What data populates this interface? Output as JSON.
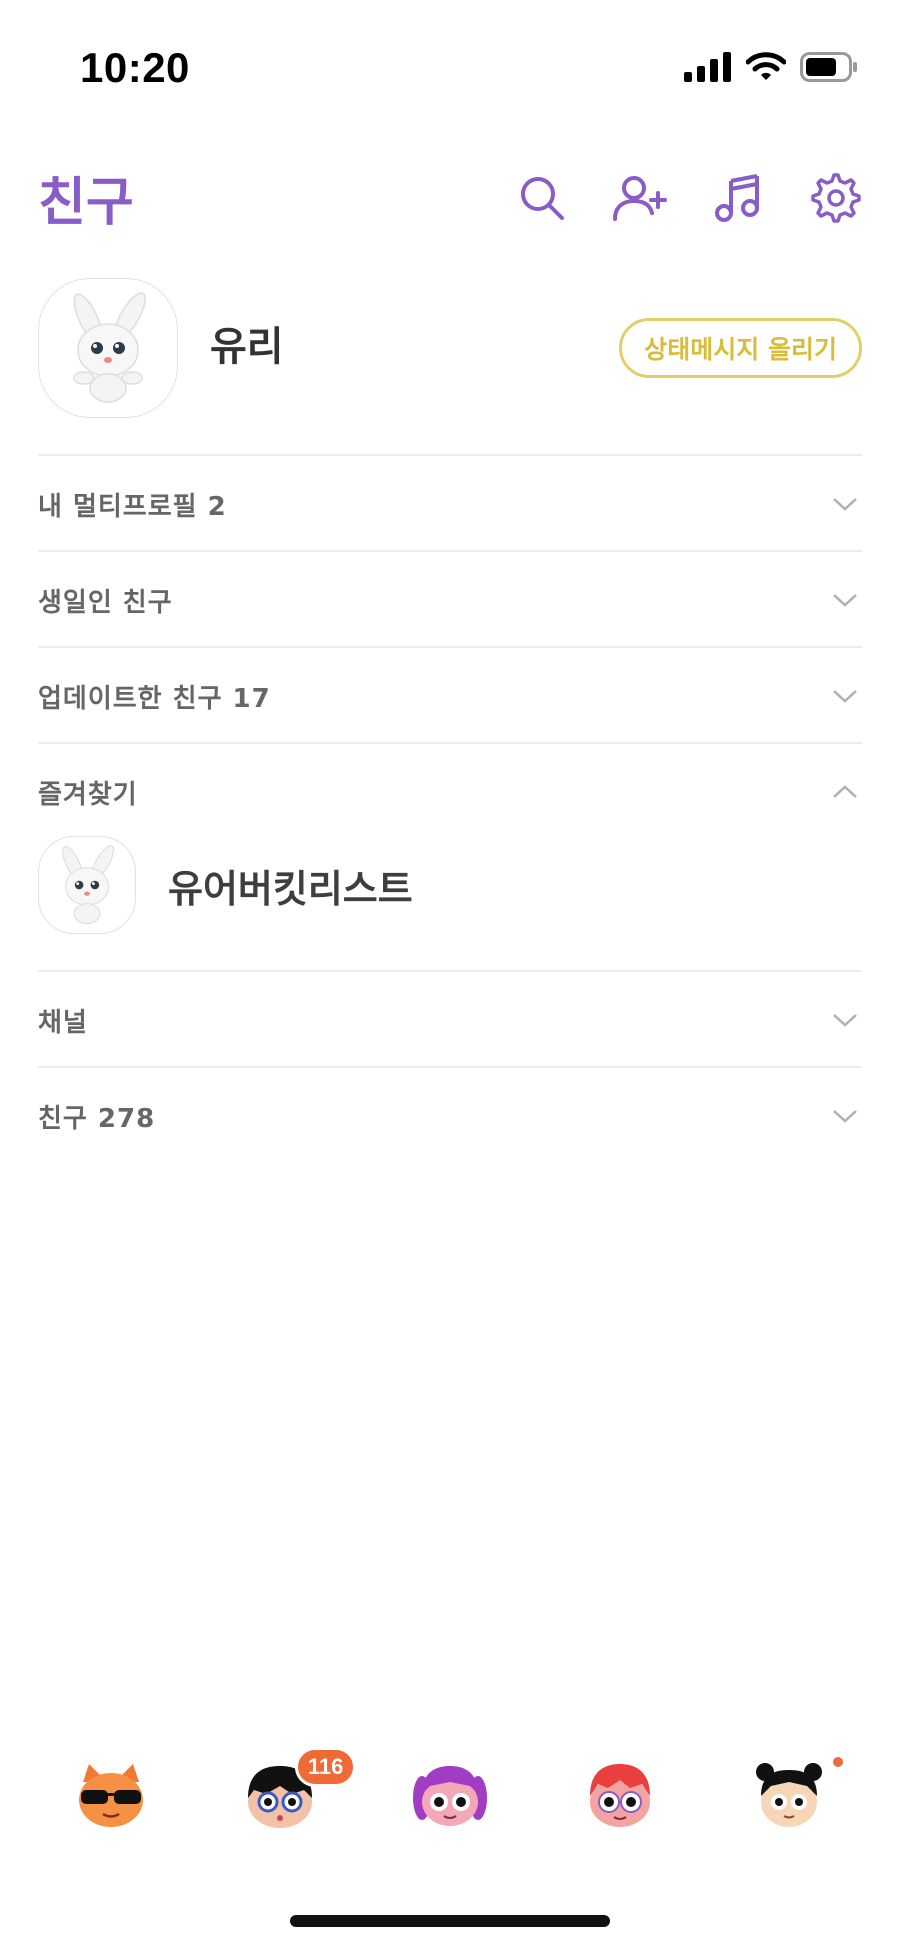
{
  "status_bar": {
    "time": "10:20"
  },
  "header": {
    "title": "친구"
  },
  "profile": {
    "name": "유리",
    "status_button": "상태메시지 올리기"
  },
  "sections": [
    {
      "label": "내 멀티프로필 2",
      "expanded": false
    },
    {
      "label": "생일인 친구",
      "expanded": false
    },
    {
      "label": "업데이트한 친구 17",
      "expanded": false
    },
    {
      "label": "즐겨찾기",
      "expanded": true
    },
    {
      "label": "채널",
      "expanded": false
    },
    {
      "label": "친구 278",
      "expanded": false
    }
  ],
  "favorites": [
    {
      "name": "유어버킷리스트"
    }
  ],
  "tabs": [
    {
      "icon": "friends-tab-icon",
      "badge": ""
    },
    {
      "icon": "chats-tab-icon",
      "badge": "116"
    },
    {
      "icon": "openchat-tab-icon",
      "badge": ""
    },
    {
      "icon": "shopping-tab-icon",
      "badge": ""
    },
    {
      "icon": "more-tab-icon",
      "badge": "",
      "dot": true
    }
  ],
  "colors": {
    "accent": "#8a5cc7",
    "status_button": "#d8bd3c",
    "badge": "#ef6a35"
  }
}
